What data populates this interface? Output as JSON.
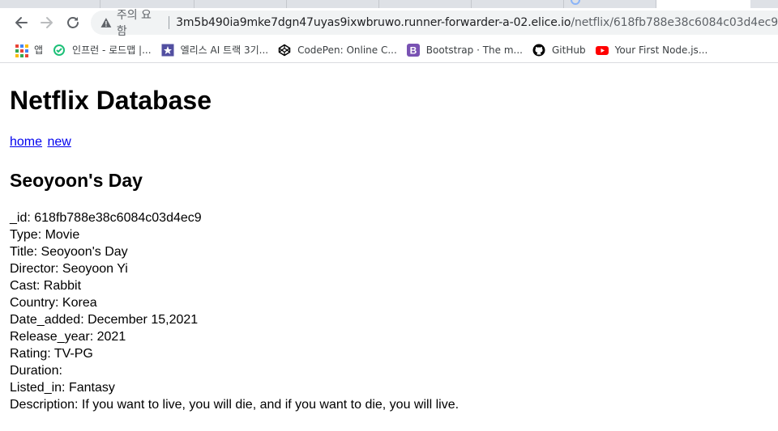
{
  "browser": {
    "url_host": "3m5b490ia9mke7dgn47uyas9ixwbruwo.runner-forwarder-a-02.elice.io",
    "url_path": "/netflix/618fb788e38c6084c03d4ec9",
    "security_label": "주의 요함",
    "bookmarks": [
      {
        "label": "앱",
        "icon": "apps-grid-icon"
      },
      {
        "label": "인프런 - 로드맵 |...",
        "icon": "inflearn-icon",
        "color": "#1dc078"
      },
      {
        "label": "엘리스 AI 트랙 3기...",
        "icon": "elice-icon",
        "color": "#524fa1"
      },
      {
        "label": "CodePen: Online C...",
        "icon": "codepen-icon",
        "color": "#000000"
      },
      {
        "label": "Bootstrap · The m...",
        "icon": "bootstrap-icon",
        "color": "#7952b3"
      },
      {
        "label": "GitHub",
        "icon": "github-icon",
        "color": "#000000"
      },
      {
        "label": "Your First Node.js...",
        "icon": "youtube-icon",
        "color": "#ff0000"
      }
    ]
  },
  "page": {
    "title": "Netflix Database",
    "nav": {
      "home": "home",
      "new": "new"
    },
    "movie_title": "Seoyoon's Day",
    "details": [
      "_id: 618fb788e38c6084c03d4ec9",
      "Type: Movie",
      "Title: Seoyoon's Day",
      "Director: Seoyoon Yi",
      "Cast: Rabbit",
      "Country: Korea",
      "Date_added: December 15,2021",
      "Release_year: 2021",
      "Rating: TV-PG",
      "Duration:",
      "Listed_in: Fantasy",
      "Description: If you want to live, you will die, and if you want to die, you will live."
    ]
  }
}
